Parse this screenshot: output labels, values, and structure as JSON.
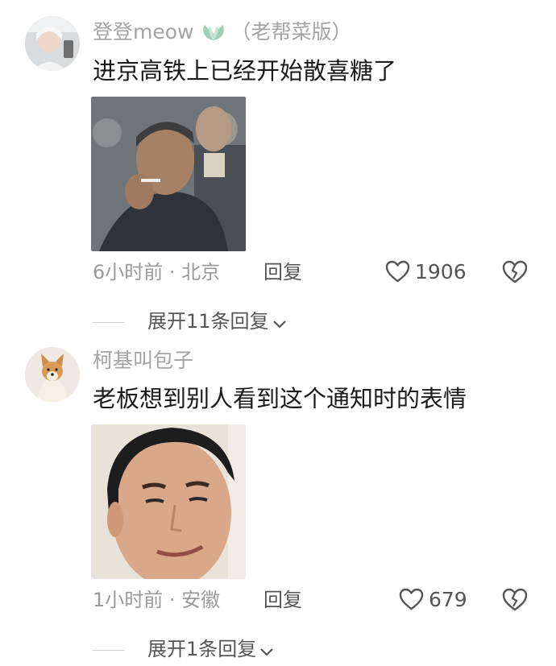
{
  "comments": [
    {
      "username": "登登meow",
      "tag": "（老帮菜版）",
      "text": "进京高铁上已经开始散喜糖了",
      "meta": "6小时前 · 北京",
      "reply_label": "回复",
      "likes": "1906",
      "expand_label": "展开11条回复"
    },
    {
      "username": "柯基叫包子",
      "text": "老板想到别人看到这个通知时的表情",
      "meta": "1小时前 · 安徽",
      "reply_label": "回复",
      "likes": "679",
      "expand_label": "展开1条回复"
    }
  ],
  "icons": {
    "badge": "leaf-badge-icon",
    "like": "heart-outline-icon",
    "dislike": "broken-heart-icon",
    "expand": "chevron-down-icon"
  },
  "colors": {
    "username": "#a3a3a3",
    "text": "#1b1b1b",
    "meta": "#9a9a9a",
    "badge": "#9fd0b6"
  }
}
